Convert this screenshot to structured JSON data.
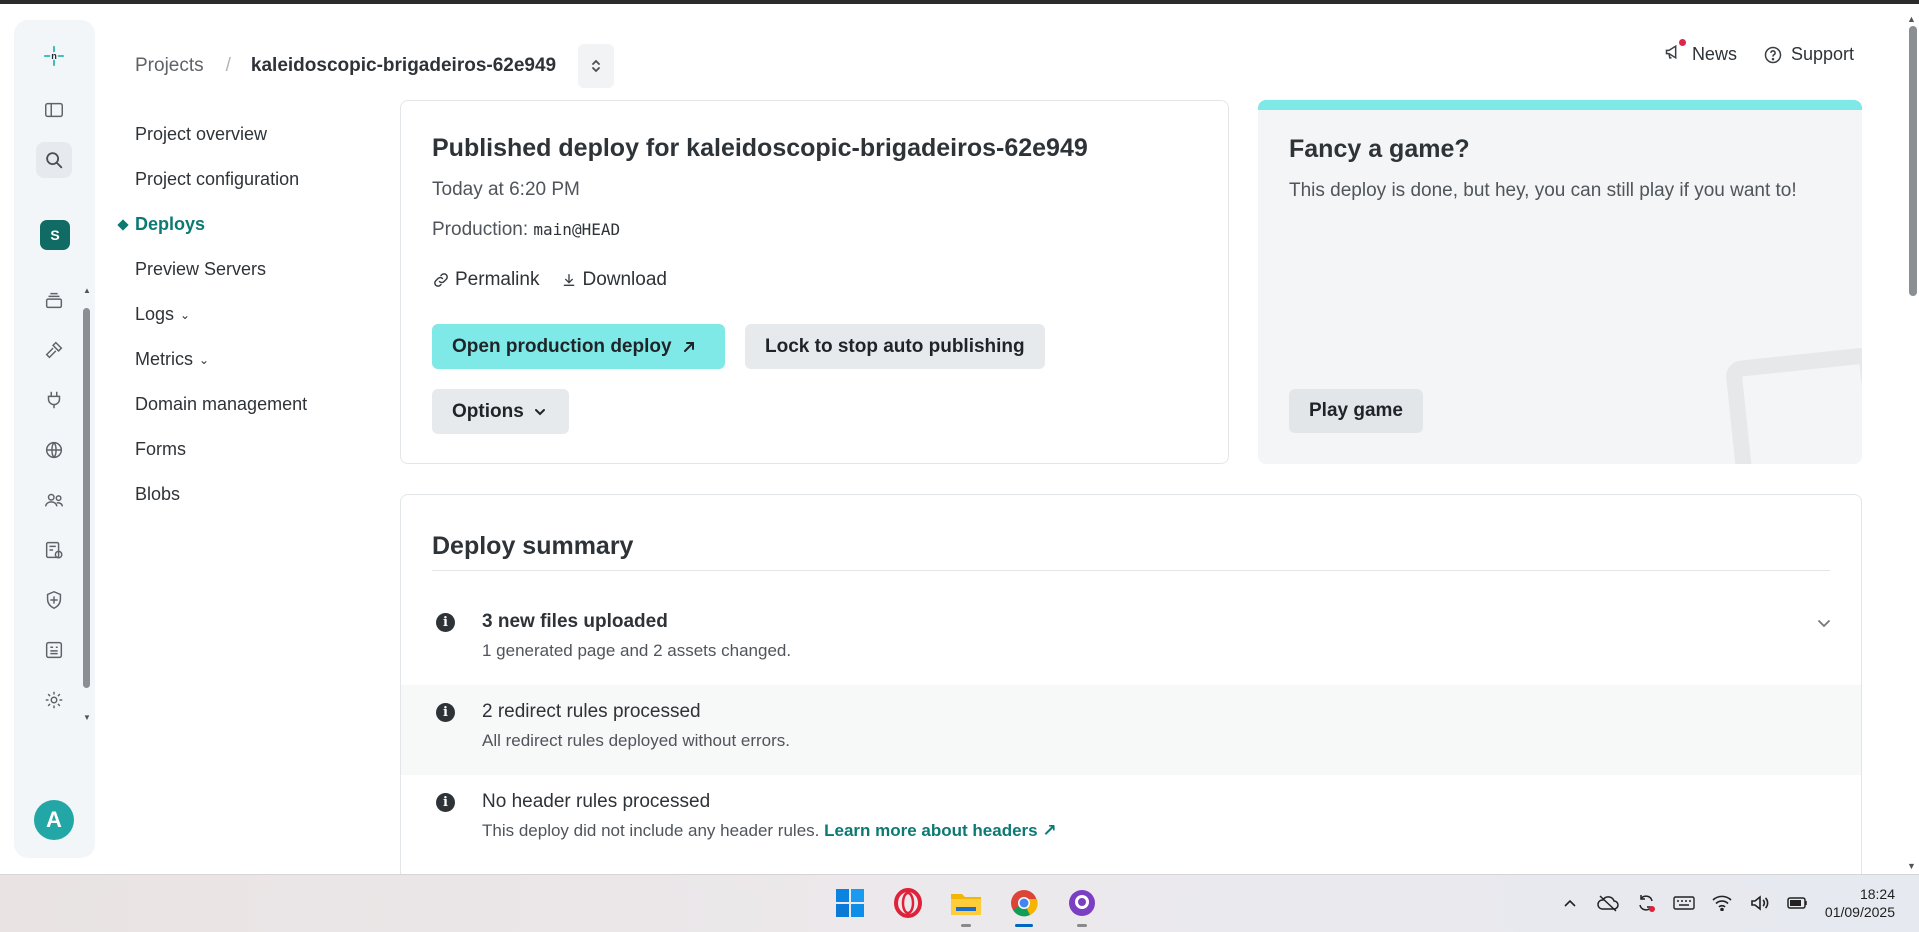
{
  "breadcrumb": {
    "projects": "Projects",
    "separator": "/",
    "current": "kaleidoscopic-brigadeiros-62e949"
  },
  "topbar": {
    "news": "News",
    "support": "Support"
  },
  "rail": {
    "team_initial": "S",
    "user_initial": "A"
  },
  "nav": {
    "items": [
      {
        "label": "Project overview"
      },
      {
        "label": "Project configuration"
      },
      {
        "label": "Deploys"
      },
      {
        "label": "Preview Servers"
      },
      {
        "label": "Logs"
      },
      {
        "label": "Metrics"
      },
      {
        "label": "Domain management"
      },
      {
        "label": "Forms"
      },
      {
        "label": "Blobs"
      }
    ]
  },
  "deploy": {
    "title": "Published deploy for kaleidoscopic-brigadeiros-62e949",
    "time": "Today at 6:20 PM",
    "production_label": "Production:",
    "production_ref": "main@HEAD",
    "permalink": "Permalink",
    "download": "Download",
    "open_button": "Open production deploy",
    "lock_button": "Lock to stop auto publishing",
    "options_button": "Options"
  },
  "game": {
    "title": "Fancy a game?",
    "text": "This deploy is done, but hey, you can still play if you want to!",
    "play_button": "Play game"
  },
  "summary": {
    "title": "Deploy summary",
    "rows": [
      {
        "title": "3 new files uploaded",
        "subtitle": "1 generated page and 2 assets changed."
      },
      {
        "title": "2 redirect rules processed",
        "subtitle": "All redirect rules deployed without errors."
      },
      {
        "title": "No header rules processed",
        "subtitle": "This deploy did not include any header rules.",
        "link": "Learn more about headers"
      }
    ]
  },
  "taskbar": {
    "time": "18:24",
    "date": "01/09/2025"
  },
  "colors": {
    "accent": "#7fe9e7",
    "brand_teal": "#0c7a73",
    "team_badge": "#0f6b63",
    "avatar": "#23a6a6"
  }
}
